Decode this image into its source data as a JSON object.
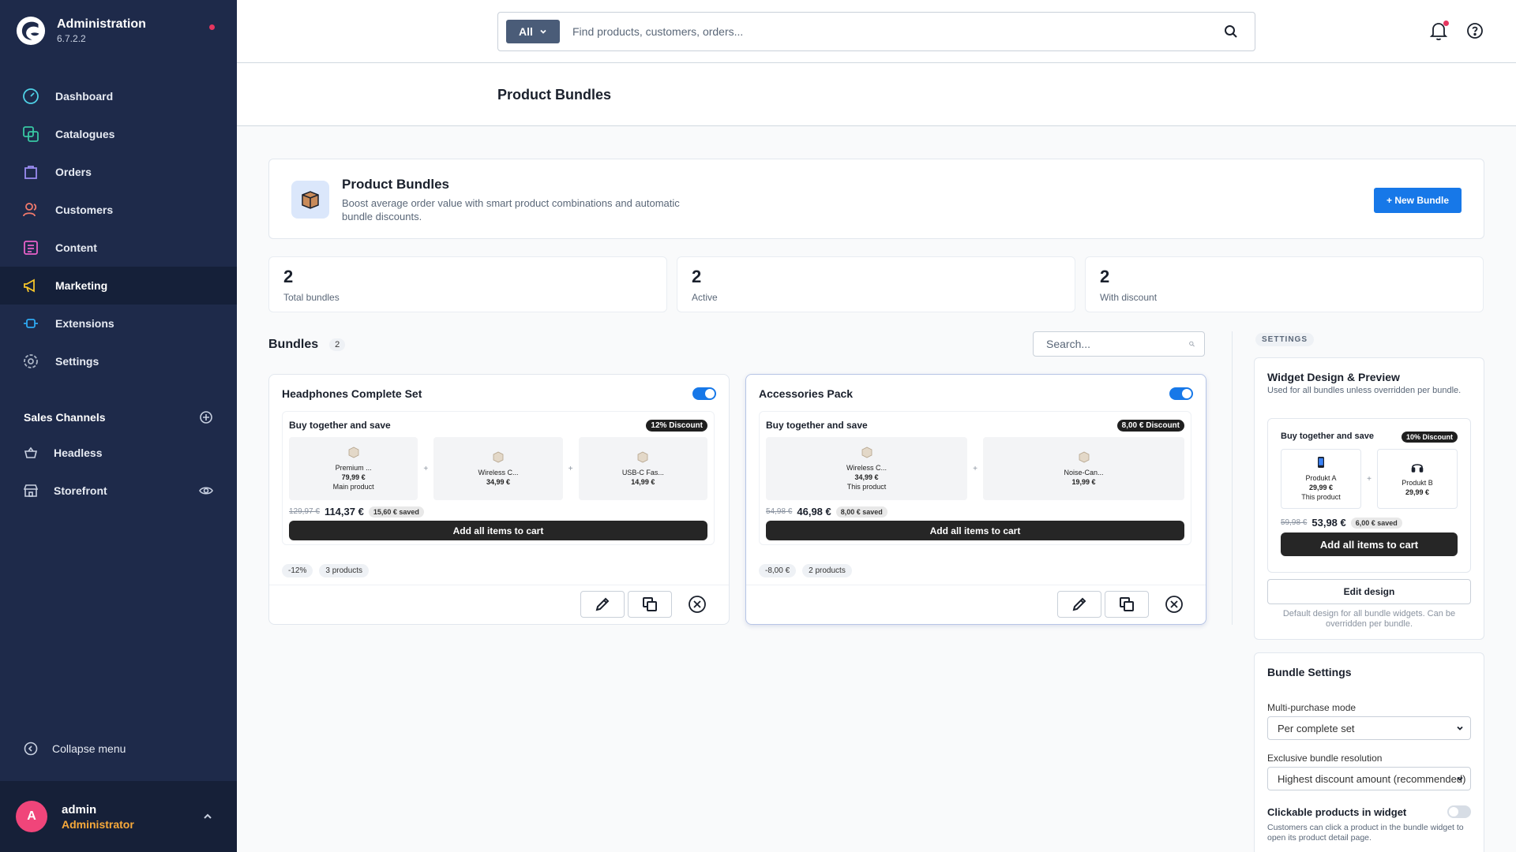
{
  "app": {
    "title": "Administration",
    "version": "6.7.2.2"
  },
  "nav": [
    {
      "label": "Dashboard",
      "icon": "dashboard-icon",
      "color": "#4fd1e6"
    },
    {
      "label": "Catalogues",
      "icon": "catalogues-icon",
      "color": "#38c7a3"
    },
    {
      "label": "Orders",
      "icon": "orders-icon",
      "color": "#9b8cf2"
    },
    {
      "label": "Customers",
      "icon": "customers-icon",
      "color": "#f27a6c"
    },
    {
      "label": "Content",
      "icon": "content-icon",
      "color": "#e861c9"
    },
    {
      "label": "Marketing",
      "icon": "marketing-icon",
      "color": "#f5c52a"
    },
    {
      "label": "Extensions",
      "icon": "extensions-icon",
      "color": "#2fa9f2"
    },
    {
      "label": "Settings",
      "icon": "settings-icon",
      "color": "#aab4c4"
    }
  ],
  "sales_channels": {
    "title": "Sales Channels",
    "items": [
      {
        "label": "Headless",
        "icon": "basket-icon"
      },
      {
        "label": "Storefront",
        "icon": "storefront-icon"
      }
    ]
  },
  "collapse_label": "Collapse menu",
  "user": {
    "initial": "A",
    "name": "admin",
    "role": "Administrator"
  },
  "search": {
    "type": "All",
    "placeholder": "Find products, customers, orders..."
  },
  "page_title": "Product Bundles",
  "hero": {
    "title": "Product Bundles",
    "description": "Boost average order value with smart product combinations and automatic bundle discounts.",
    "button": "+ New Bundle"
  },
  "stats": [
    {
      "value": "2",
      "label": "Total bundles"
    },
    {
      "value": "2",
      "label": "Active"
    },
    {
      "value": "2",
      "label": "With discount"
    }
  ],
  "bundles_section": {
    "title": "Bundles",
    "count": "2",
    "search_placeholder": "Search..."
  },
  "bundles": [
    {
      "name": "Headphones Complete Set",
      "active": true,
      "widget_title": "Buy together and save",
      "discount_badge": "12% Discount",
      "products": [
        {
          "name": "Premium ...",
          "price": "79,99 €",
          "note": "Main product"
        },
        {
          "name": "Wireless C...",
          "price": "34,99 €",
          "note": ""
        },
        {
          "name": "USB-C Fas...",
          "price": "14,99 €",
          "note": ""
        }
      ],
      "old_price": "129,97 €",
      "new_price": "114,37 €",
      "saved": "15,60 € saved",
      "cart_button": "Add all items to cart",
      "tags": [
        "-12%",
        "3 products"
      ]
    },
    {
      "name": "Accessories Pack",
      "active": true,
      "widget_title": "Buy together and save",
      "discount_badge": "8,00 € Discount",
      "products": [
        {
          "name": "Wireless C...",
          "price": "34,99 €",
          "note": "This product"
        },
        {
          "name": "Noise-Can...",
          "price": "19,99 €",
          "note": ""
        }
      ],
      "old_price": "54,98 €",
      "new_price": "46,98 €",
      "saved": "8,00 € saved",
      "cart_button": "Add all items to cart",
      "tags": [
        "-8,00 €",
        "2 products"
      ]
    }
  ],
  "settings_chip": "SETTINGS",
  "widget_design": {
    "title": "Widget Design & Preview",
    "subtitle": "Used for all bundles unless overridden per bundle.",
    "preview": {
      "title": "Buy together and save",
      "badge": "10% Discount",
      "products": [
        {
          "name": "Produkt A",
          "price": "29,99 €",
          "note": "This product",
          "icon": "phone-icon"
        },
        {
          "name": "Produkt B",
          "price": "29,99 €",
          "note": "",
          "icon": "headphones-icon"
        }
      ],
      "old_price": "59,98 €",
      "new_price": "53,98 €",
      "saved": "6,00 € saved",
      "cart_button": "Add all items to cart"
    },
    "edit_button": "Edit design",
    "note": "Default design for all bundle widgets. Can be overridden per bundle."
  },
  "bundle_settings": {
    "title": "Bundle Settings",
    "multi_label": "Multi-purchase mode",
    "multi_value": "Per complete set",
    "exclusive_label": "Exclusive bundle resolution",
    "exclusive_value": "Highest discount amount (recommended)",
    "clickable_label": "Clickable products in widget",
    "clickable_on": false,
    "clickable_desc": "Customers can click a product in the bundle widget to open its product detail page."
  },
  "colors": {
    "sidebar": "#1e2a4a",
    "primary": "#1778e8",
    "accent_orange": "#f7a93a",
    "alert": "#e6365f"
  }
}
